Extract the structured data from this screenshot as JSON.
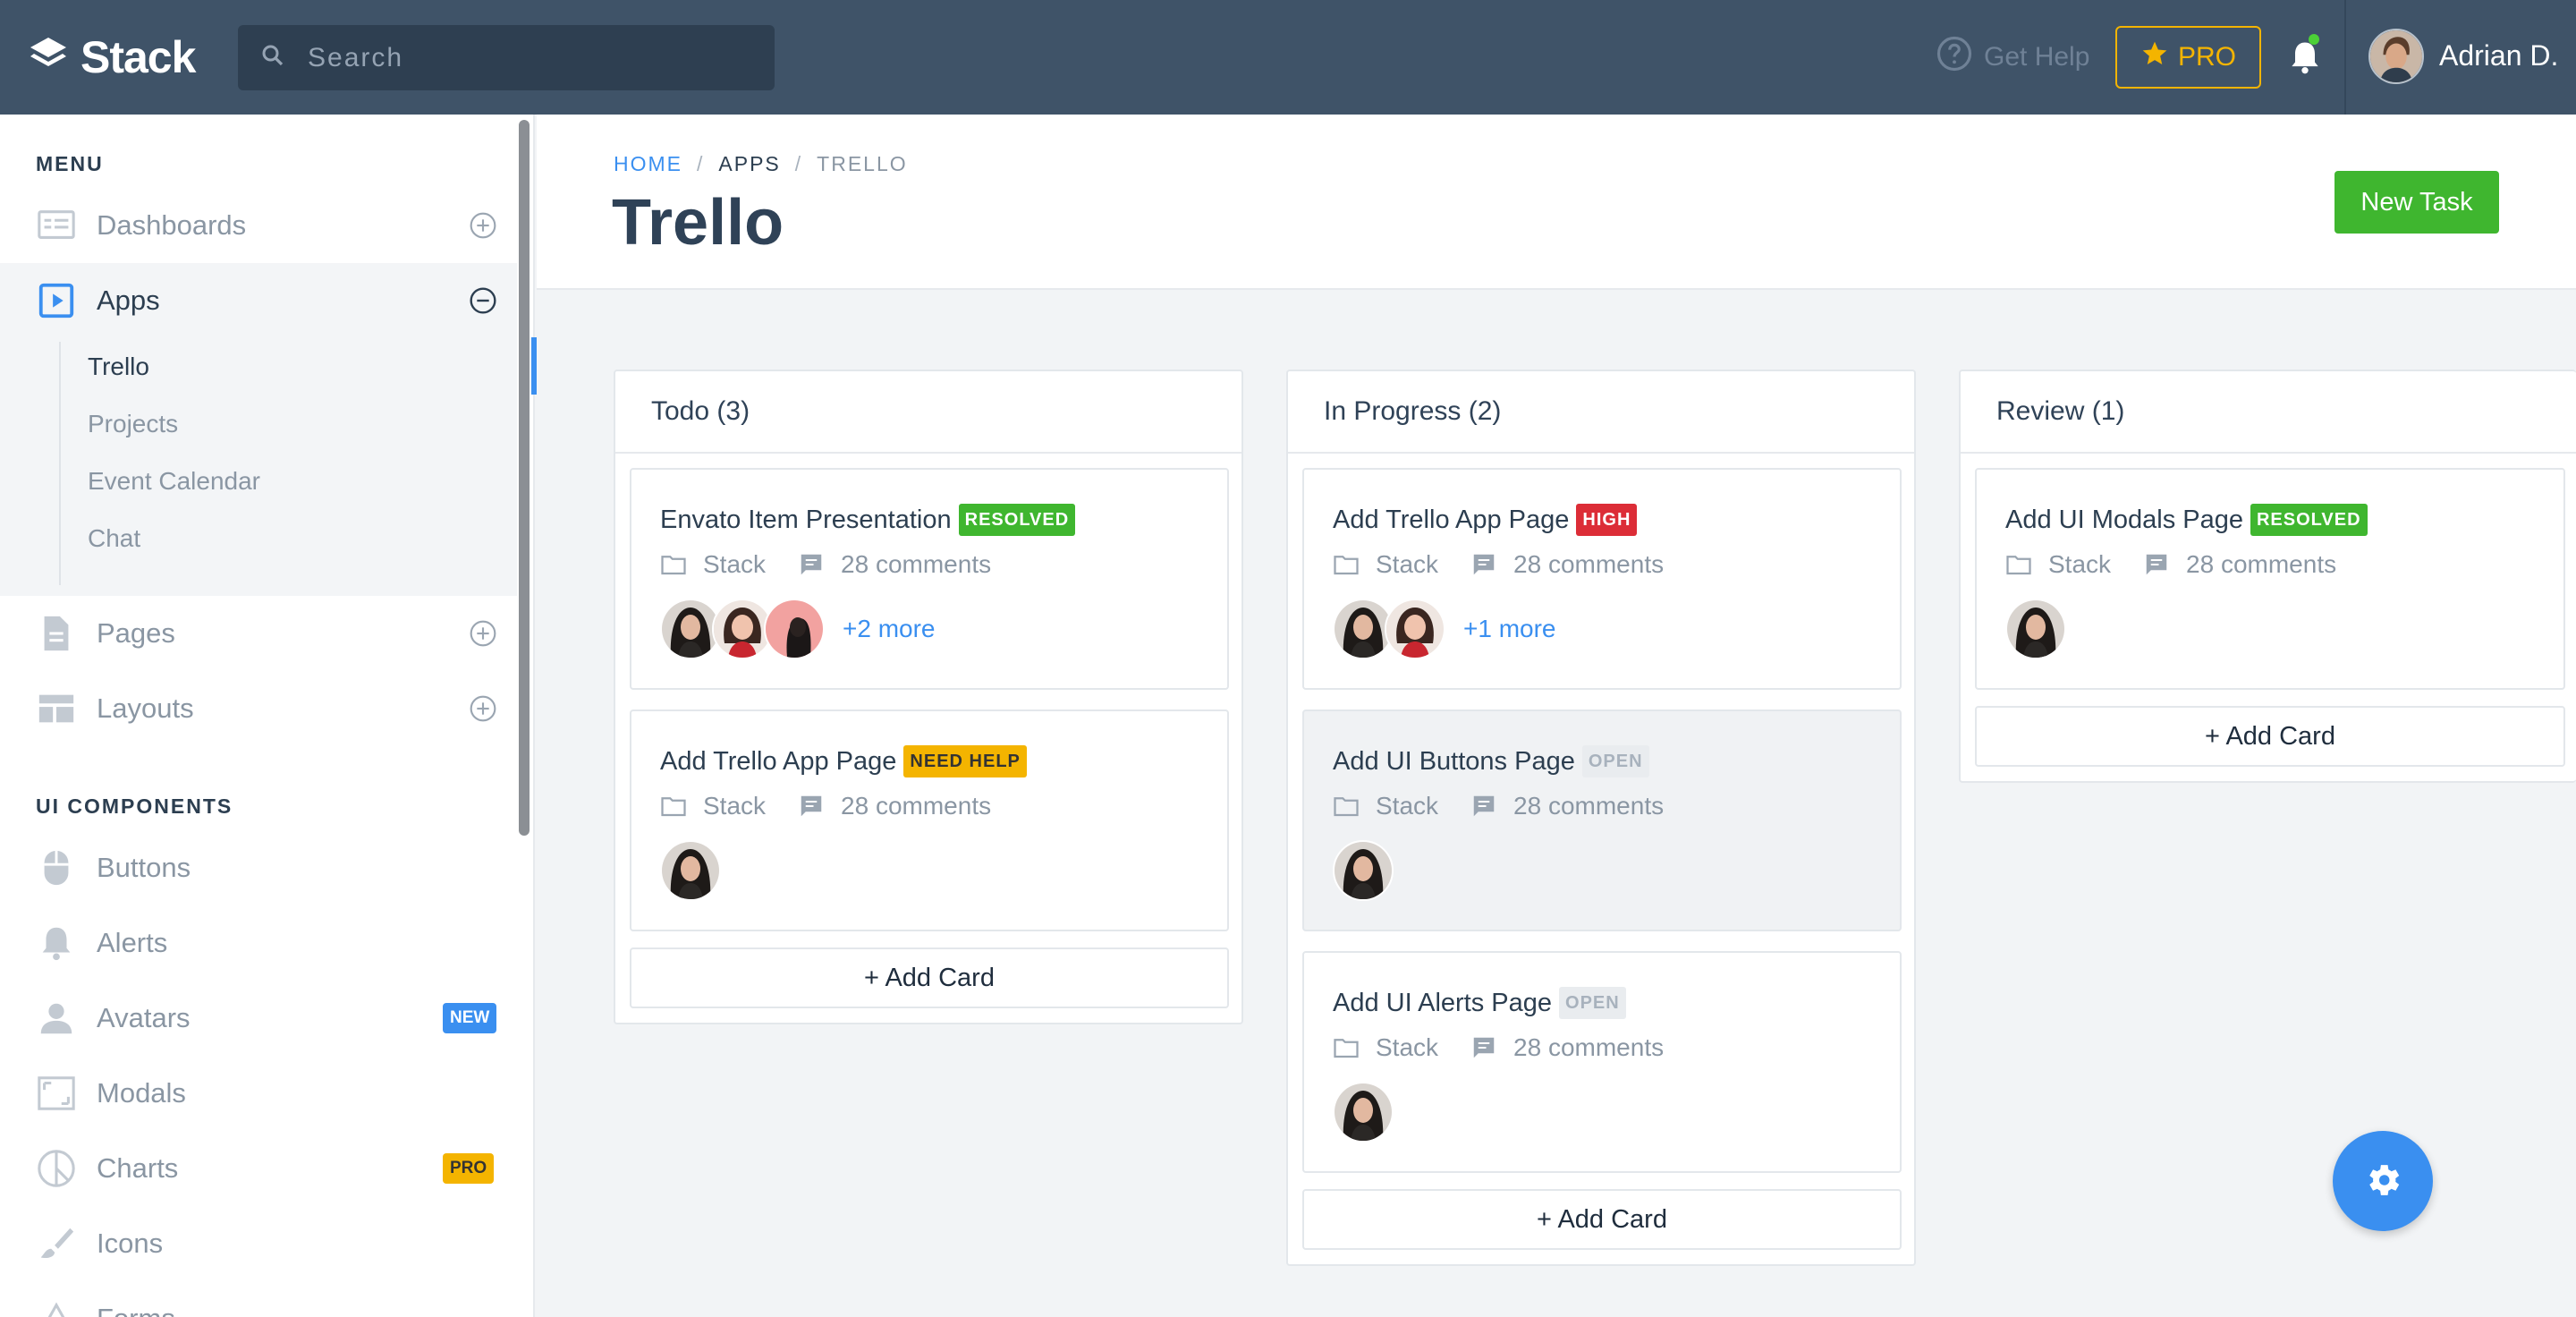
{
  "app": {
    "name": "Stack"
  },
  "search": {
    "placeholder": "Search"
  },
  "topbar": {
    "get_help": "Get Help",
    "pro_label": "PRO",
    "user_name": "Adrian D."
  },
  "sidebar": {
    "menu_heading": "MENU",
    "items": [
      {
        "label": "Dashboards",
        "icon": "dashboard-icon"
      },
      {
        "label": "Apps",
        "icon": "play-square-icon"
      },
      {
        "label": "Pages",
        "icon": "file-icon"
      },
      {
        "label": "Layouts",
        "icon": "layout-icon"
      }
    ],
    "apps_sub": [
      "Trello",
      "Projects",
      "Event Calendar",
      "Chat"
    ],
    "ui_heading": "UI COMPONENTS",
    "ui_items": [
      {
        "label": "Buttons",
        "icon": "mouse-icon"
      },
      {
        "label": "Alerts",
        "icon": "bell-icon"
      },
      {
        "label": "Avatars",
        "icon": "person-icon",
        "badge": "NEW"
      },
      {
        "label": "Modals",
        "icon": "modal-icon"
      },
      {
        "label": "Charts",
        "icon": "pie-chart-icon",
        "badge": "PRO"
      },
      {
        "label": "Icons",
        "icon": "brush-icon"
      },
      {
        "label": "Forms",
        "icon": "triangle-icon"
      }
    ]
  },
  "breadcrumb": {
    "home": "HOME",
    "sep": "/",
    "apps": "APPS",
    "current": "TRELLO"
  },
  "page": {
    "title": "Trello",
    "new_task": "New Task"
  },
  "board": {
    "add_card": "+ Add Card",
    "columns": [
      {
        "title": "Todo (3)",
        "cards": [
          {
            "title": "Envato Item Presentation",
            "tag": "RESOLVED",
            "project": "Stack",
            "comments": "28 comments",
            "more": "+2 more"
          },
          {
            "title": "Add Trello App Page",
            "tag": "NEED HELP",
            "project": "Stack",
            "comments": "28 comments"
          }
        ]
      },
      {
        "title": "In Progress (2)",
        "cards": [
          {
            "title": "Add Trello App Page",
            "tag": "HIGH",
            "project": "Stack",
            "comments": "28 comments",
            "more": "+1 more"
          },
          {
            "title": "Add UI Buttons Page",
            "tag": "OPEN",
            "project": "Stack",
            "comments": "28 comments"
          },
          {
            "title": "Add UI Alerts Page",
            "tag": "OPEN",
            "project": "Stack",
            "comments": "28 comments"
          }
        ]
      },
      {
        "title": "Review (1)",
        "cards": [
          {
            "title": "Add UI Modals Page",
            "tag": "RESOLVED",
            "project": "Stack",
            "comments": "28 comments"
          }
        ]
      }
    ]
  },
  "colors": {
    "topbar": "#3f5368",
    "accent": "#3a8ff0",
    "success": "#3fb62f",
    "warning": "#f4b400",
    "danger": "#dc2d37"
  }
}
